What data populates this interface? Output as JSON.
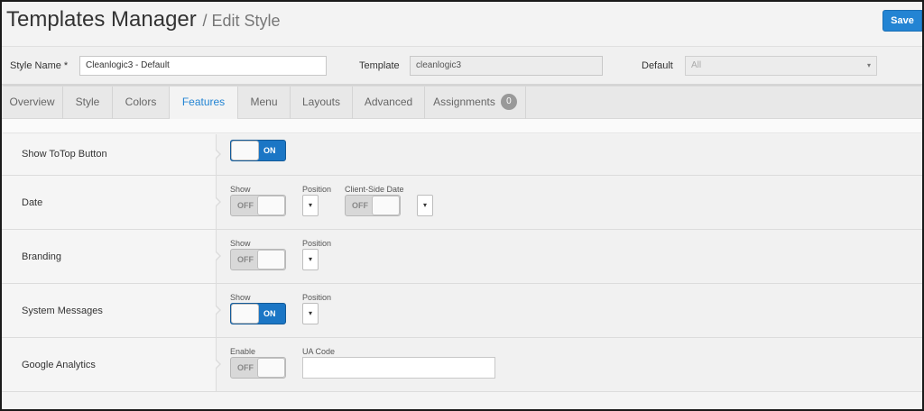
{
  "header": {
    "title": "Templates Manager",
    "subtitle": "/ Edit Style",
    "save_label": "Save"
  },
  "fields": {
    "style_name_label": "Style Name *",
    "style_name_value": "Cleanlogic3 - Default",
    "template_label": "Template",
    "template_value": "cleanlogic3",
    "default_label": "Default",
    "default_value": "All"
  },
  "tabs": [
    {
      "label": "Overview"
    },
    {
      "label": "Style"
    },
    {
      "label": "Colors"
    },
    {
      "label": "Features",
      "active": true
    },
    {
      "label": "Menu"
    },
    {
      "label": "Layouts"
    },
    {
      "label": "Advanced"
    },
    {
      "label": "Assignments",
      "badge": "0"
    }
  ],
  "features": {
    "totop": {
      "label": "Show ToTop Button",
      "toggle": "ON"
    },
    "date": {
      "label": "Date",
      "show_label": "Show",
      "show_toggle": "OFF",
      "position_label": "Position",
      "client_label": "Client-Side Date",
      "client_toggle": "OFF"
    },
    "branding": {
      "label": "Branding",
      "show_label": "Show",
      "show_toggle": "OFF",
      "position_label": "Position"
    },
    "sysmsg": {
      "label": "System Messages",
      "show_label": "Show",
      "show_toggle": "ON",
      "position_label": "Position"
    },
    "analytics": {
      "label": "Google Analytics",
      "enable_label": "Enable",
      "enable_toggle": "OFF",
      "ua_label": "UA Code",
      "ua_value": ""
    }
  },
  "icons": {
    "select_caret": "▾"
  },
  "colors": {
    "accent": "#2384d3",
    "toggle_on": "#1b76c5"
  }
}
